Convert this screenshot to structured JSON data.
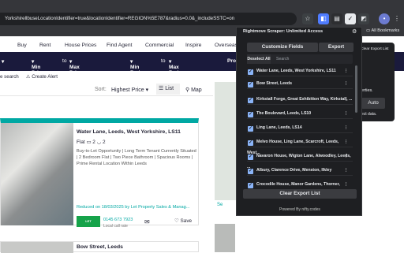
{
  "browser": {
    "url": "YorkshirellbuseLocationIdentifier=true&locationIdentifier=REGION%5E787&radius=0.0&_includeSSTC=on",
    "bookmarks_label": "All Bookmarks"
  },
  "nav": {
    "items": [
      "Buy",
      "Rent",
      "House Prices",
      "Find Agent",
      "Commercial",
      "Inspire",
      "Overseas"
    ]
  },
  "filters": {
    "min_price": "Min Price",
    "to1": "to",
    "max_price": "Max Price",
    "min_beds": "Min Beds",
    "to2": "to",
    "max_beds": "Max Beds",
    "prop": "Prop"
  },
  "subbar": {
    "search": "e search",
    "create_alert": "Create Alert"
  },
  "sort": {
    "label": "Sort:",
    "value": "Highest Price",
    "list": "List",
    "map": "Map"
  },
  "listing": {
    "title": "Water Lane, Leeds, West Yorkshire, LS11",
    "type": "Flat",
    "beds": "2",
    "baths": "2",
    "description": "Buy-to-Let Opportunity | Long Term Tenant Currently Situated | 2 Bedroom Flat | Two Piece Bathroom | Spacious Rooms | Prime Rental Location Within Leeds",
    "reduced": "Reduced on 18/03/2025 by Let Property Sales & Manag...",
    "phone": "0145 673 7923",
    "local_call": "Local call rate",
    "save": "Save",
    "agent_logo": "LET PROPERTY"
  },
  "listing2": {
    "title": "Bow Street, Leeds"
  },
  "popup": {
    "title": "Rightmove Scraper: Unlimited Access",
    "customize": "Customize Fields",
    "export": "Export",
    "deselect": "Deselect All",
    "search_placeholder": "Search",
    "items": [
      "Water Lane, Leeds, West Yorkshire, LS11",
      "Bow Street, Leeds",
      "Kirkstall Forge, Great Exhibition Way, Kirkstall, ...",
      "The Boulevard, Leeds, LS10",
      "Ling Lane, Leeds, LS14",
      "Melvo House, Ling Lane, Scarcroft, Leeds, West...",
      "Navaron House, Wigton Lane, Alwoodley, Leeds, ...",
      "Albury, Clarence Drive, Menston, Ilkley",
      "Crocodile House, Manor Gardens, Thorner, Leeds"
    ],
    "clear": "Clear Export List",
    "powered": "Powered By nifty.codes"
  },
  "right_panel": {
    "clear_export": "Clear Export List",
    "partial1": "erties.",
    "auto": "Auto",
    "partial2": "ect data."
  },
  "colors": {
    "accent": "#00a8a3",
    "filter_bar": "#1a1a3c",
    "popup_bg": "#1e1f22",
    "checkbox": "#8ab4f8"
  }
}
